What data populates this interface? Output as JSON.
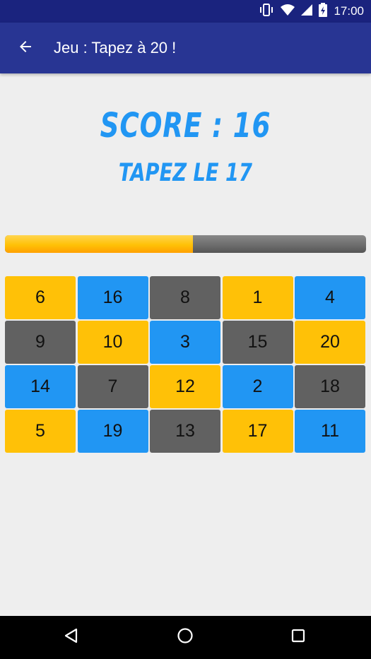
{
  "status_bar": {
    "time": "17:00"
  },
  "app_bar": {
    "title": "Jeu : Tapez à 20 !"
  },
  "game": {
    "score_text": "SCORE : 16",
    "instruction": "TAPEZ LE 17",
    "progress": 0.52,
    "cells": [
      {
        "label": "6",
        "color": "#FFC107"
      },
      {
        "label": "16",
        "color": "#2196F3"
      },
      {
        "label": "8",
        "color": "#616161"
      },
      {
        "label": "1",
        "color": "#FFC107"
      },
      {
        "label": "4",
        "color": "#2196F3"
      },
      {
        "label": "9",
        "color": "#616161"
      },
      {
        "label": "10",
        "color": "#FFC107"
      },
      {
        "label": "3",
        "color": "#2196F3"
      },
      {
        "label": "15",
        "color": "#616161"
      },
      {
        "label": "20",
        "color": "#FFC107"
      },
      {
        "label": "14",
        "color": "#2196F3"
      },
      {
        "label": "7",
        "color": "#616161"
      },
      {
        "label": "12",
        "color": "#FFC107"
      },
      {
        "label": "2",
        "color": "#2196F3"
      },
      {
        "label": "18",
        "color": "#616161"
      },
      {
        "label": "5",
        "color": "#FFC107"
      },
      {
        "label": "19",
        "color": "#2196F3"
      },
      {
        "label": "13",
        "color": "#616161"
      },
      {
        "label": "17",
        "color": "#FFC107"
      },
      {
        "label": "11",
        "color": "#2196F3"
      }
    ]
  },
  "colors": {
    "accent": "#2196F3",
    "app_bar": "#283593",
    "status_bar": "#1A237E",
    "progress_fill": "#FFC107"
  },
  "icons": [
    "vibrate-icon",
    "wifi-icon",
    "signal-icon",
    "battery-charging-icon",
    "back-arrow-icon",
    "nav-back-icon",
    "nav-home-icon",
    "nav-recents-icon"
  ]
}
